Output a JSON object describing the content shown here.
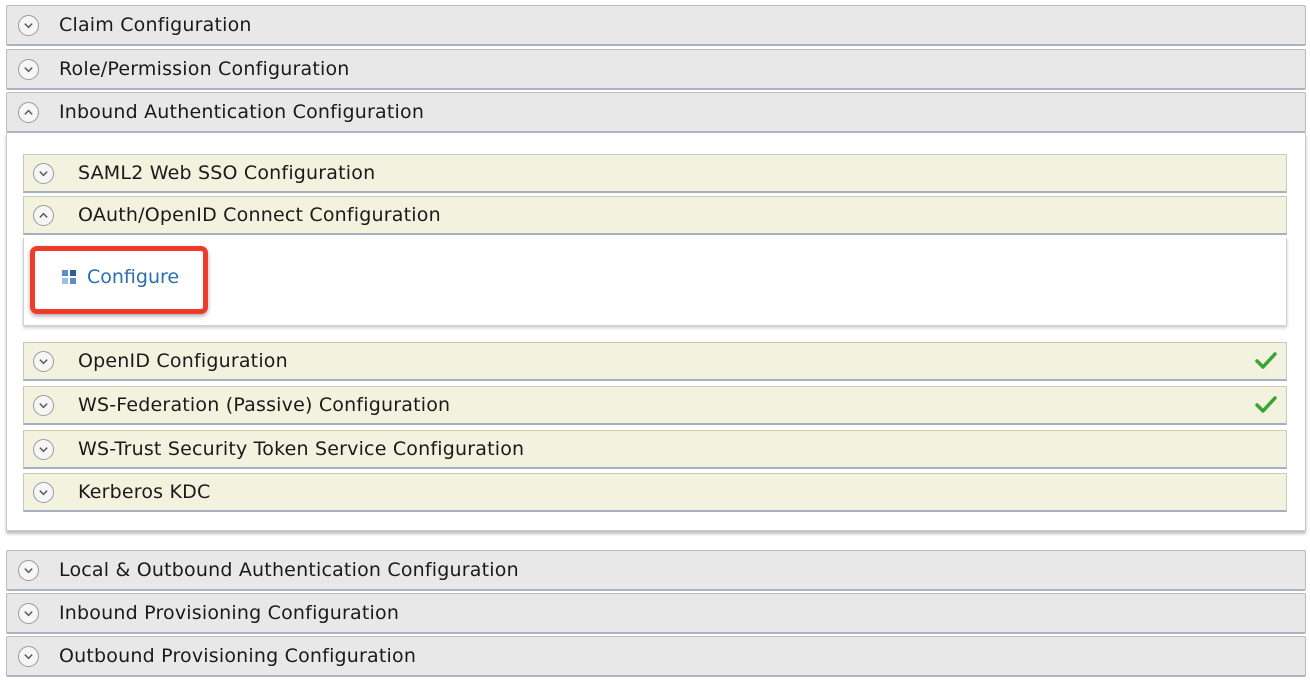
{
  "sections": {
    "claim": {
      "label": "Claim Configuration"
    },
    "role": {
      "label": "Role/Permission Configuration"
    },
    "inbound_auth": {
      "label": "Inbound Authentication Configuration"
    },
    "local_outbound": {
      "label": "Local & Outbound Authentication Configuration"
    },
    "inbound_prov": {
      "label": "Inbound Provisioning Configuration"
    },
    "outbound_prov": {
      "label": "Outbound Provisioning Configuration"
    }
  },
  "inbound": {
    "saml": {
      "label": "SAML2 Web SSO Configuration"
    },
    "oauth": {
      "label": "OAuth/OpenID Connect Configuration",
      "configure_label": "Configure"
    },
    "openid": {
      "label": "OpenID Configuration",
      "configured": true
    },
    "wsfed": {
      "label": "WS-Federation (Passive) Configuration",
      "configured": true
    },
    "wstrust": {
      "label": "WS-Trust Security Token Service Configuration"
    },
    "kerberos": {
      "label": "Kerberos KDC"
    }
  },
  "colors": {
    "outer_header_bg": "#e8e8e8",
    "inner_header_bg": "#f3f2df",
    "link": "#2a6fad",
    "check": "#3aa335",
    "highlight": "#f03a2a"
  }
}
